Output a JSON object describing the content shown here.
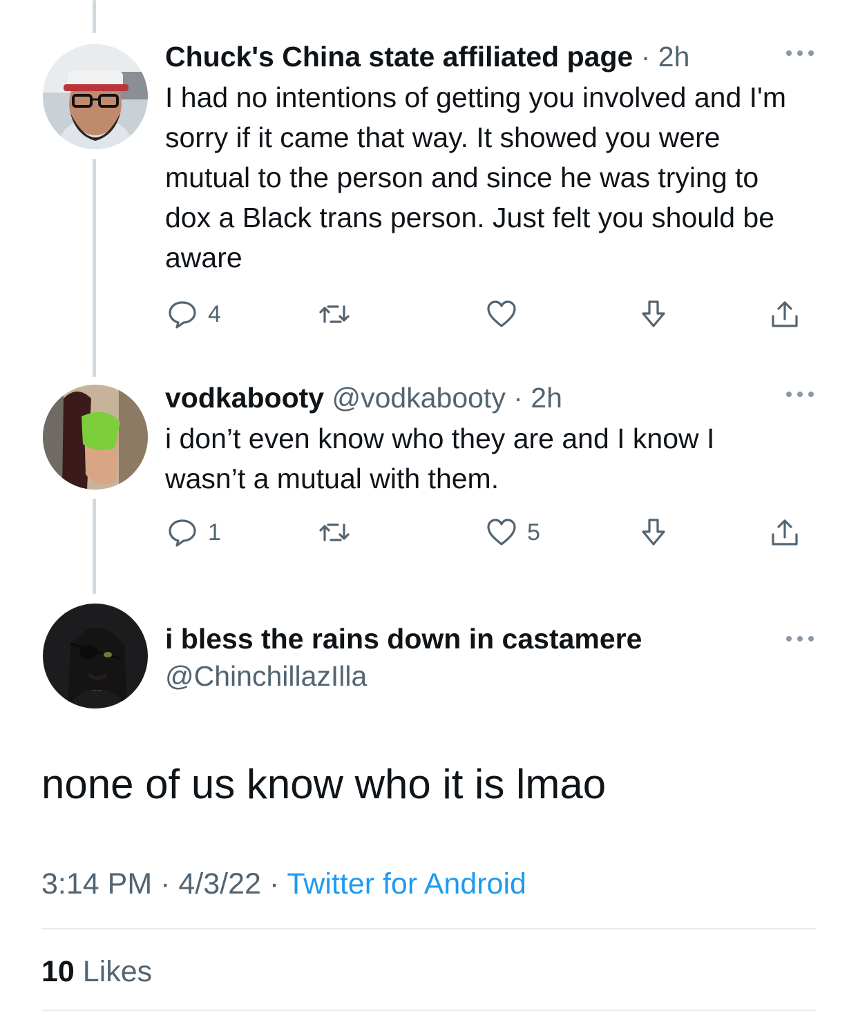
{
  "thread": [
    {
      "display_name": "Chuck's China state affiliated page",
      "handle": "",
      "separator": "·",
      "time": "2h",
      "text": "I had no intentions of getting you involved and I'm sorry if it came that way. It showed you were mutual to the person and since he was trying to dox a Black trans person. Just felt you should be aware",
      "reply_count": "4",
      "retweet_count": "",
      "like_count": "",
      "avatar_icon": "user-avatar-chuck"
    },
    {
      "display_name": "vodkabooty",
      "handle": "@vodkabooty",
      "separator": "·",
      "time": "2h",
      "text": "i don’t even know who they are and I know I wasn’t a mutual with them.",
      "reply_count": "1",
      "retweet_count": "",
      "like_count": "5",
      "avatar_icon": "user-avatar-vodkabooty"
    }
  ],
  "focused": {
    "display_name": "i bless the rains down in castamere",
    "handle": "@ChinchillazIlla",
    "text": "none of us know who it is lmao",
    "time": "3:14 PM",
    "date": "4/3/22",
    "separator": "·",
    "source": "Twitter for Android",
    "likes_count": "10",
    "likes_label": "Likes"
  },
  "colors": {
    "text": "#0f1419",
    "muted": "#536471",
    "link": "#1d9bf0",
    "thread_line": "#cfd9de",
    "divider": "#e6ecf0"
  }
}
